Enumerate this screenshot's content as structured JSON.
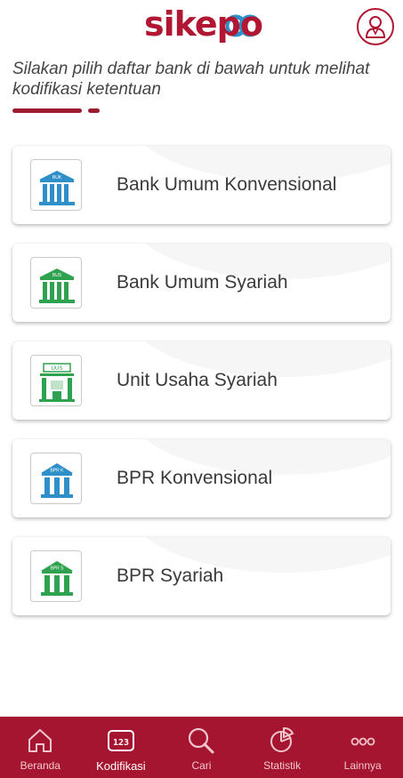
{
  "app": {
    "logo_text": "sikepo"
  },
  "intro": {
    "text": "Silakan pilih daftar bank di bawah untuk melihat kodifikasi ketentuan"
  },
  "cards": [
    {
      "label": "Bank Umum Konvensional",
      "icon_text": "BUK",
      "icon": "bank-building-icon",
      "accent": "#2f8fc9"
    },
    {
      "label": "Bank Umum Syariah",
      "icon_text": "BUS",
      "icon": "bank-building-icon",
      "accent": "#2fa24f"
    },
    {
      "label": "Unit Usaha Syariah",
      "icon_text": "UUS",
      "icon": "shop-building-icon",
      "accent": "#2fa24f"
    },
    {
      "label": "BPR Konvensional",
      "icon_text": "BPR K",
      "icon": "bank-building-icon",
      "accent": "#2f8fc9"
    },
    {
      "label": "BPR Syariah",
      "icon_text": "BPR S",
      "icon": "bank-building-icon",
      "accent": "#2fa24f"
    }
  ],
  "nav": {
    "items": [
      {
        "label": "Beranda",
        "icon": "home-icon",
        "active": false
      },
      {
        "label": "Kodifikasi",
        "icon": "numeric-123-icon",
        "active": true
      },
      {
        "label": "Cari",
        "icon": "search-icon",
        "active": false
      },
      {
        "label": "Statistik",
        "icon": "pie-chart-icon",
        "active": false
      },
      {
        "label": "Lainnya",
        "icon": "more-icon",
        "active": false
      }
    ],
    "background": "#a51530"
  },
  "colors": {
    "brand": "#b11733"
  }
}
